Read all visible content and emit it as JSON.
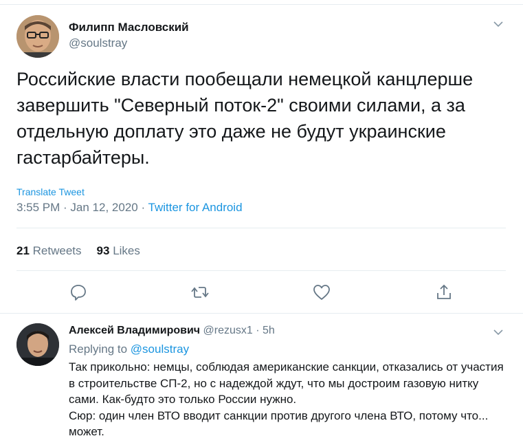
{
  "tweet": {
    "author_name": "Филипп Масловский",
    "author_handle": "@soulstray",
    "text": "Российские власти пообещали немецкой канцлерше завершить \"Северный поток-2\" своими силами, а за отдельную доплату это даже не будут украинские гастарбайтеры.",
    "translate_label": "Translate Tweet",
    "timestamp": "3:55 PM · Jan 12, 2020 · ",
    "source": "Twitter for Android",
    "retweets_count": "21",
    "retweets_label": "Retweets",
    "likes_count": "93",
    "likes_label": "Likes"
  },
  "actions": {
    "icons": [
      "reply-icon",
      "retweet-icon",
      "like-icon",
      "share-icon"
    ]
  },
  "reply": {
    "author_name": "Алексей Владимирович",
    "author_handle": "@rezusx1",
    "time": " · 5h",
    "replying_prefix": "Replying to ",
    "replying_to": "@soulstray",
    "text": "Так прикольно: немцы, соблюдая американские санкции, отказались от участия в строительстве СП-2, но с надеждой ждут, что мы достроим газовую нитку сами. Как-будто это только России нужно.",
    "text2": "Сюр: один член ВТО вводит санкции против другого члена ВТО, потому что... может."
  },
  "colors": {
    "accent": "#1b95e0",
    "muted": "#657786",
    "text": "#14171a",
    "divider": "#e6ecf0"
  }
}
